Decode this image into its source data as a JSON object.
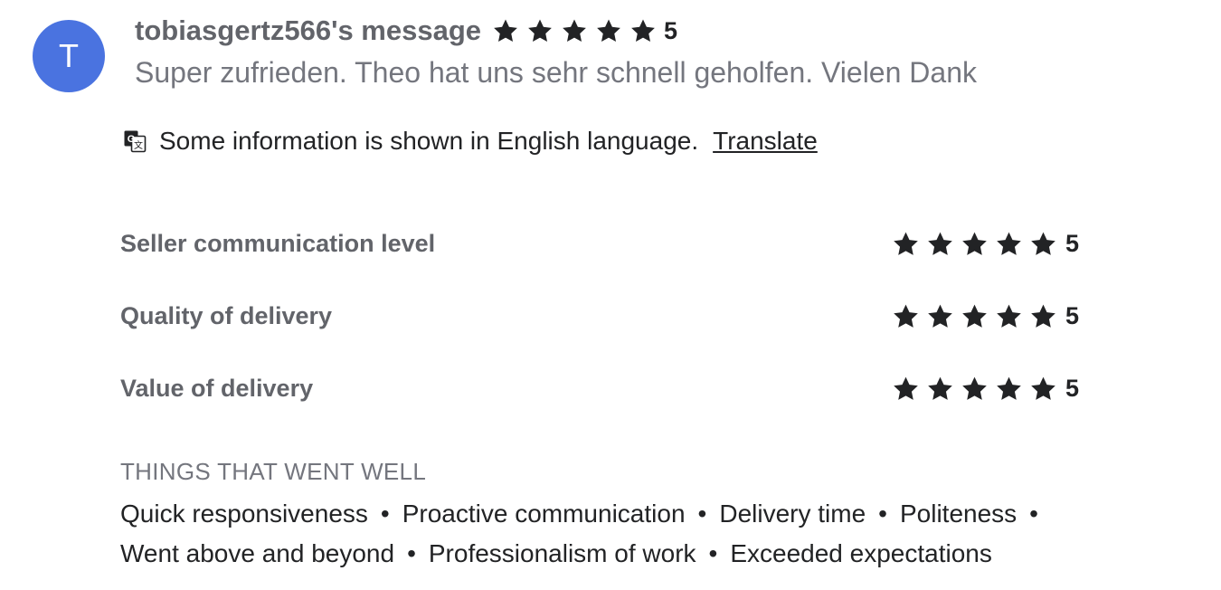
{
  "review": {
    "avatar_letter": "T",
    "avatar_color": "#4a73e0",
    "username_label": "tobiasgertz566's message",
    "rating": 5,
    "rating_text": "5",
    "message": "Super zufrieden. Theo hat uns sehr schnell geholfen. Vielen Dank"
  },
  "translation": {
    "icon": "translate-icon",
    "notice": "Some information is shown in English language.",
    "link_label": "Translate"
  },
  "criteria": [
    {
      "label": "Seller communication level",
      "rating": 5,
      "rating_text": "5"
    },
    {
      "label": "Quality of delivery",
      "rating": 5,
      "rating_text": "5"
    },
    {
      "label": "Value of delivery",
      "rating": 5,
      "rating_text": "5"
    }
  ],
  "went_well": {
    "title": "THINGS THAT WENT WELL",
    "tags_line1": [
      "Quick responsiveness",
      "Proactive communication",
      "Delivery time",
      "Politeness"
    ],
    "tags_line2": [
      "Went above and beyond",
      "Professionalism of work",
      "Exceeded expectations"
    ],
    "separator": "•"
  },
  "colors": {
    "star": "#222325",
    "accent": "#4a73e0"
  }
}
